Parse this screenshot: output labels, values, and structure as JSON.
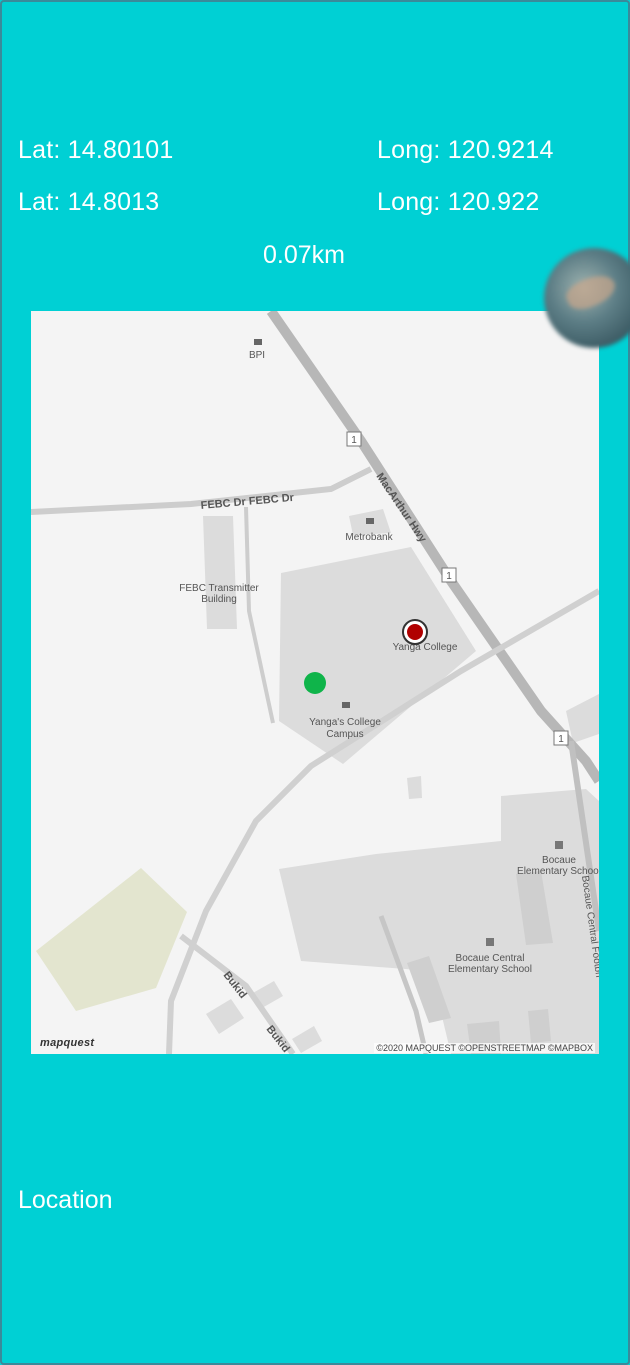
{
  "coords": {
    "lat_1": "Lat: 14.80101",
    "long_1": "Long: 120.9214",
    "lat_2": "Lat: 14.8013",
    "long_2": "Long: 120.922"
  },
  "distance": "0.07km",
  "map": {
    "labels": {
      "bpi": "BPI",
      "febc_dr": "FEBC Dr  FEBC Dr",
      "macarthur": "MacArthur Hwy",
      "metrobank": "Metrobank",
      "febc_building_1": "FEBC Transmitter",
      "febc_building_2": "Building",
      "yanga_college": "Yanga College",
      "yanga_campus_1": "Yanga's College",
      "yanga_campus_2": "Campus",
      "bocaue_elem_1": "Bocaue",
      "bocaue_elem_2": "Elementary School",
      "bocaue_central_1": "Bocaue Central",
      "bocaue_central_2": "Elementary School",
      "bocaue_footbridge": "Bocaue Central Footbri",
      "bukid_1": "Bukid",
      "bukid_2": "Bukid",
      "route_1": "1"
    },
    "attribution": "©2020 MAPQUEST ©OPENSTREETMAP ©MAPBOX",
    "logo": "mapquest",
    "markers": {
      "current_color": "#0fb44a",
      "destination_color": "#b00000"
    }
  },
  "location_label": "Location",
  "colors": {
    "background": "#00d0d4",
    "text": "#ffffff"
  }
}
